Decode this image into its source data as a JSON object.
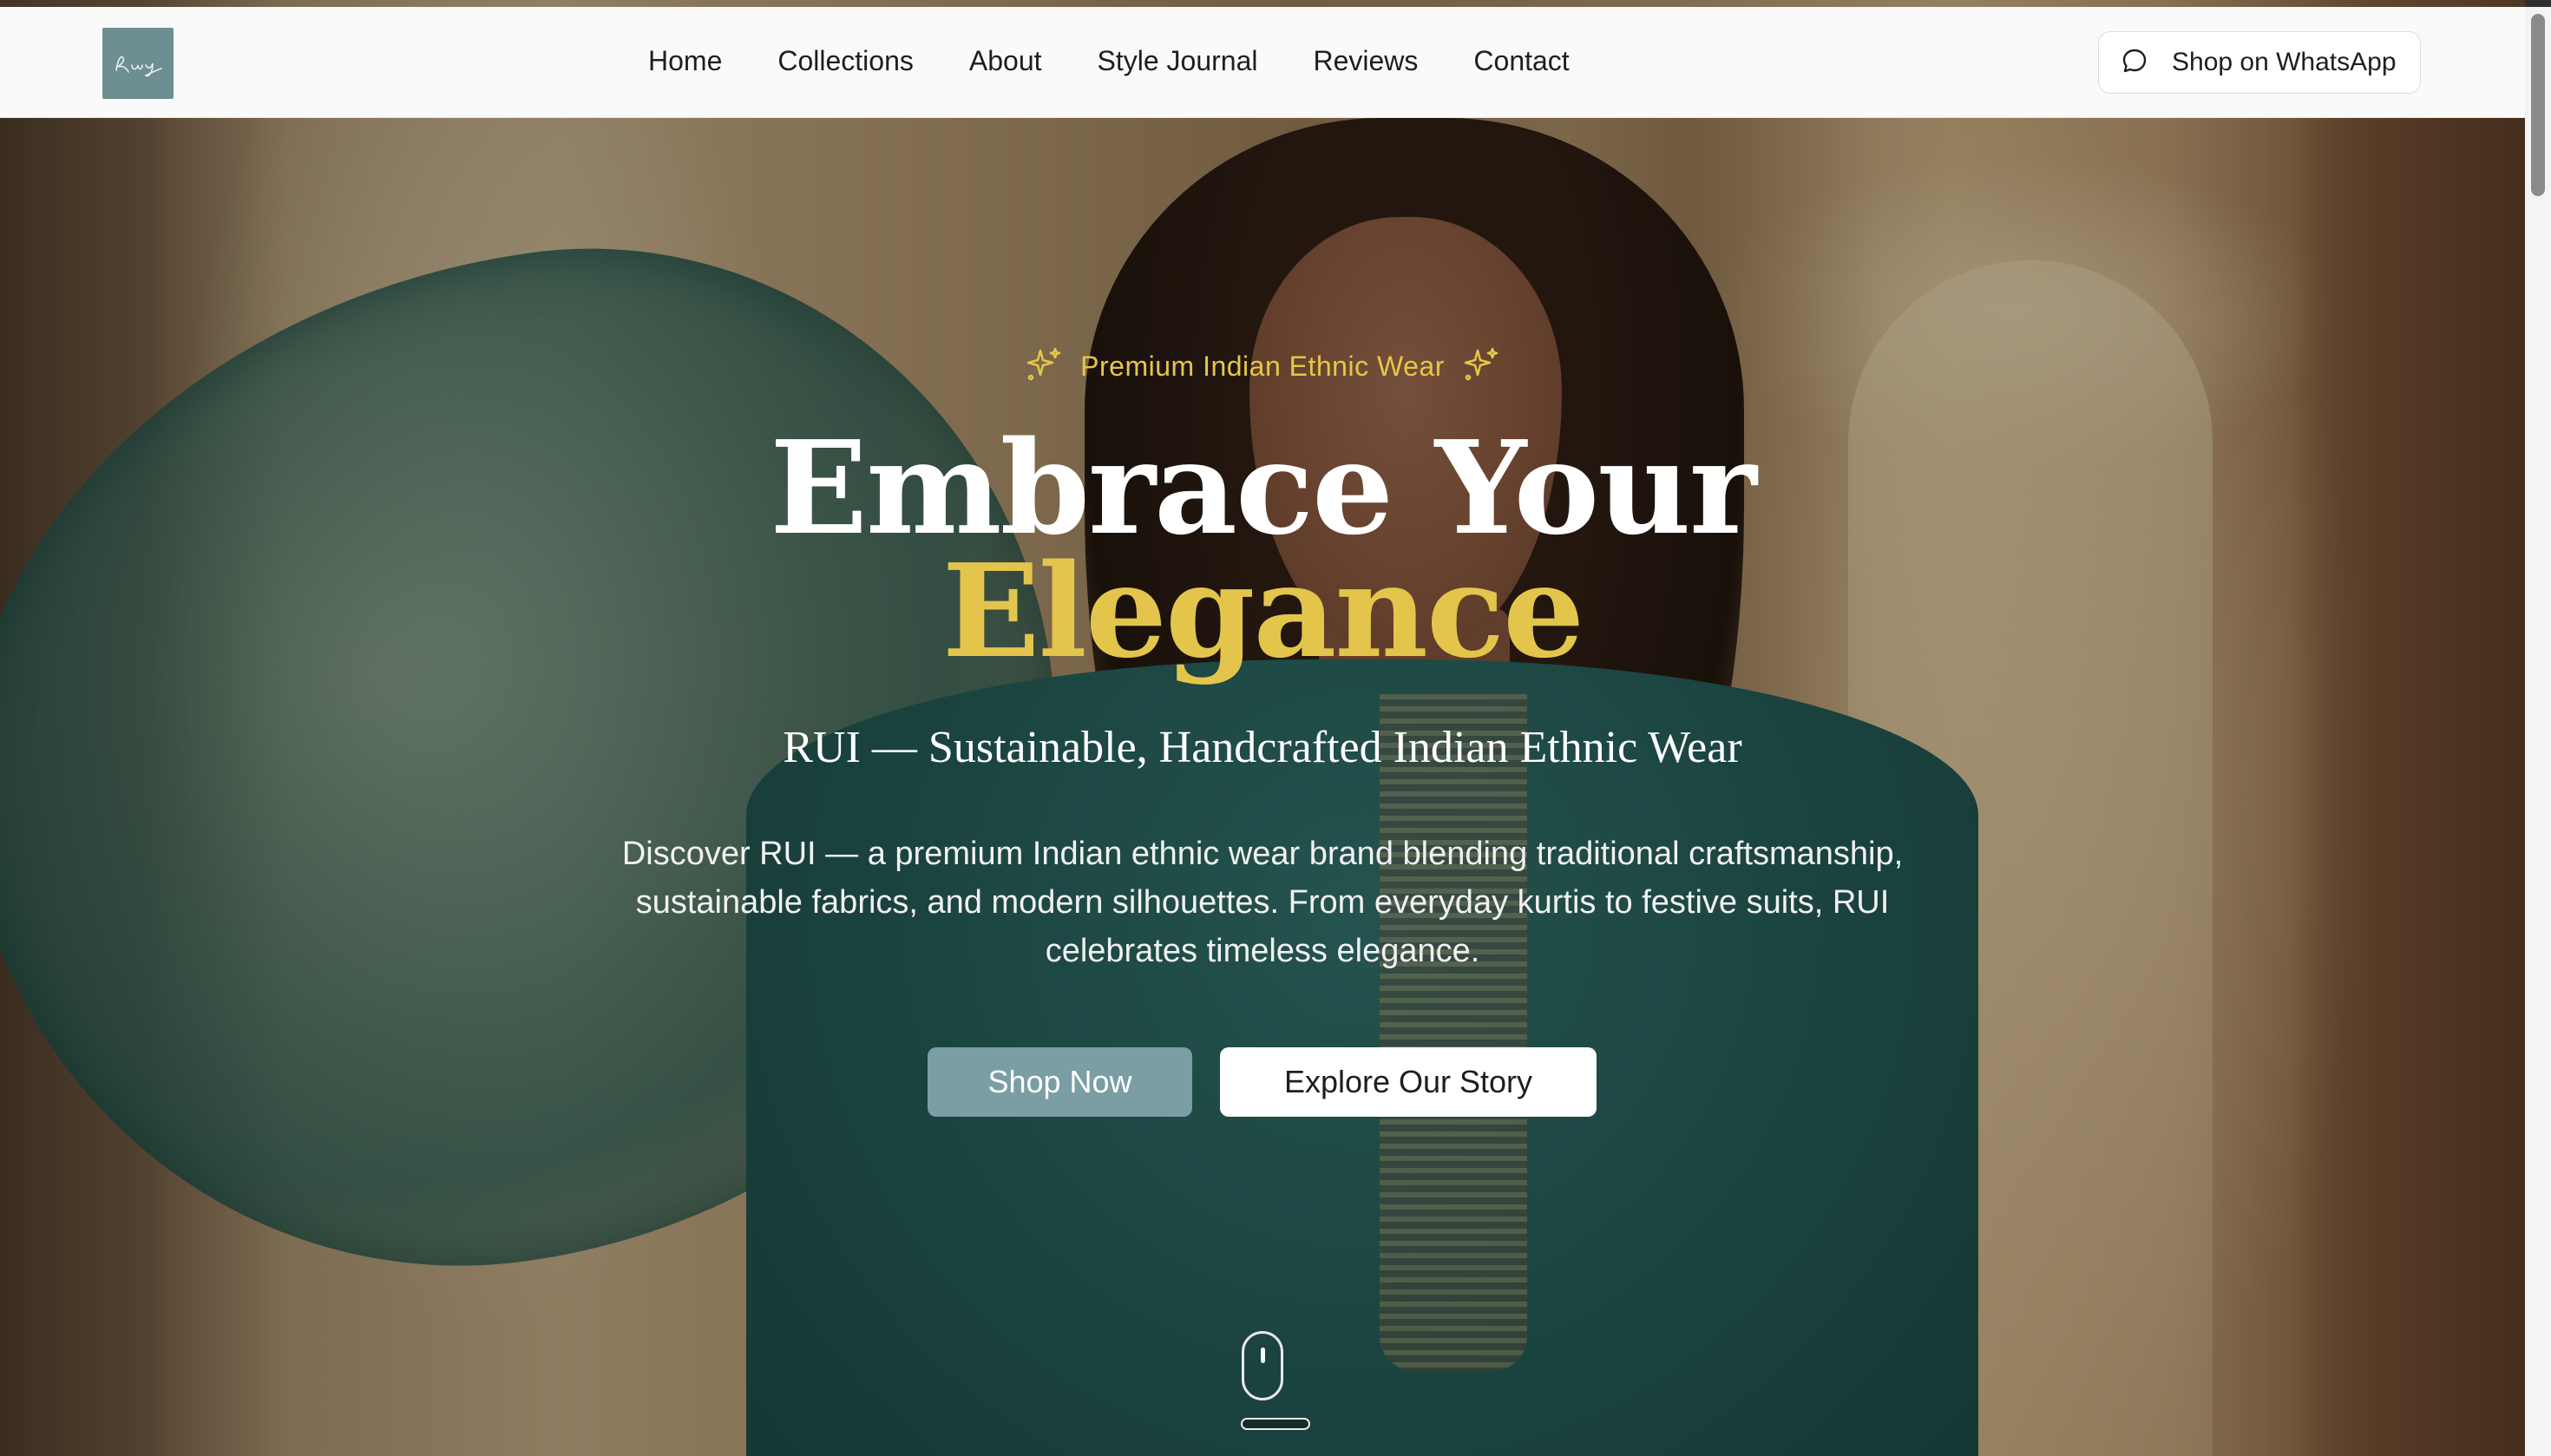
{
  "header": {
    "logo_text": "Rui",
    "nav": [
      {
        "label": "Home"
      },
      {
        "label": "Collections"
      },
      {
        "label": "About"
      },
      {
        "label": "Style Journal"
      },
      {
        "label": "Reviews"
      },
      {
        "label": "Contact"
      }
    ],
    "whatsapp_label": "Shop on WhatsApp",
    "whatsapp_icon": "chat-bubble-icon"
  },
  "hero": {
    "eyebrow": "Premium Indian Ethnic Wear",
    "eyebrow_icon": "sparkles-icon",
    "headline_line1": "Embrace Your",
    "headline_line2": "Elegance",
    "subtitle": "RUI — Sustainable, Handcrafted Indian Ethnic Wear",
    "description": "Discover RUI — a premium Indian ethnic wear brand blending traditional craftsmanship, sustainable fabrics, and modern silhouettes. From everyday kurtis to festive suits, RUI celebrates timeless elegance.",
    "primary_cta": "Shop Now",
    "secondary_cta": "Explore Our Story",
    "scroll_indicator_icon": "mouse-scroll-icon"
  },
  "colors": {
    "accent_gold": "#e4c54c",
    "button_teal": "#7a9ea3",
    "header_bg": "#fafafa"
  }
}
